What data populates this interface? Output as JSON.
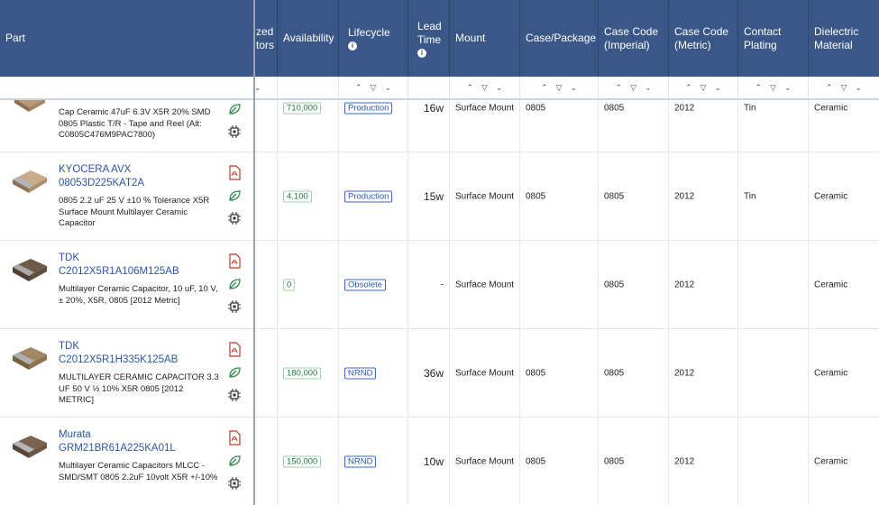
{
  "header": {
    "part": "Part",
    "hidden_col": [
      "zed",
      "tors"
    ],
    "availability": "Availability",
    "lifecycle": "Lifecycle",
    "lead_time": [
      "Lead",
      "Time"
    ],
    "mount": "Mount",
    "case_package": "Case/Package",
    "case_imperial": [
      "Case Code",
      "(Imperial)"
    ],
    "case_metric": [
      "Case Code",
      "(Metric)"
    ],
    "contact_plating": [
      "Contact",
      "Plating"
    ],
    "dielectric": [
      "Dielectric",
      "Material"
    ],
    "info_glyph": "i"
  },
  "rows": [
    {
      "manufacturer": "",
      "part_number": "",
      "description": "Cap Ceramic 47uF 6.3V X5R 20% SMD 0805 Plastic T/R - Tape and Reel (Alt: C0805C476M9PAC7800)",
      "availability": "710,000",
      "lifecycle": "Production",
      "lead_time": "16w",
      "mount": "Surface Mount",
      "case_package": "0805",
      "case_imperial": "0805",
      "case_metric": "2012",
      "contact_plating": "Tin",
      "dielectric": "Ceramic",
      "has_pdf": false
    },
    {
      "manufacturer": "KYOCERA AVX",
      "part_number": "08053D225KAT2A",
      "description": "0805 2.2 uF 25 V ±10 % Tolerance X5R Surface Mount Multilayer Ceramic Capacitor",
      "availability": "4,100",
      "lifecycle": "Production",
      "lead_time": "15w",
      "mount": "Surface Mount",
      "case_package": "0805",
      "case_imperial": "0805",
      "case_metric": "2012",
      "contact_plating": "Tin",
      "dielectric": "Ceramic",
      "has_pdf": true
    },
    {
      "manufacturer": "TDK",
      "part_number": "C2012X5R1A106M125AB",
      "description": "Multilayer Ceramic Capacitor, 10 uF, 10 V, ± 20%, X5R, 0805 [2012 Metric]",
      "availability": "0",
      "lifecycle": "Obsolete",
      "lead_time": "-",
      "mount": "Surface Mount",
      "case_package": "",
      "case_imperial": "0805",
      "case_metric": "2012",
      "contact_plating": "",
      "dielectric": "Ceramic",
      "has_pdf": true
    },
    {
      "manufacturer": "TDK",
      "part_number": "C2012X5R1H335K125AB",
      "description": "MULTILAYER CERAMIC CAPACITOR 3.3 UF 50 V ½ 10% X5R 0805 [2012 METRIC]",
      "availability": "180,000",
      "lifecycle": "NRND",
      "lead_time": "36w",
      "mount": "Surface Mount",
      "case_package": "0805",
      "case_imperial": "0805",
      "case_metric": "2012",
      "contact_plating": "",
      "dielectric": "Ceramic",
      "has_pdf": true
    },
    {
      "manufacturer": "Murata",
      "part_number": "GRM21BR61A225KA01L",
      "description": "Multilayer Ceramic Capacitors MLCC - SMD/SMT 0805 2.2uF 10volt X5R +/-10%",
      "availability": "150,000",
      "lifecycle": "NRND",
      "lead_time": "10w",
      "mount": "Surface Mount",
      "case_package": "0805",
      "case_imperial": "0805",
      "case_metric": "2012",
      "contact_plating": "",
      "dielectric": "Ceramic",
      "has_pdf": true
    }
  ],
  "colors": {
    "header_bg": "#3a5787",
    "link": "#2a56a8",
    "availability": "#1f7a3d",
    "lifecycle": "#2a58b5",
    "pdf": "#c0392b",
    "leaf": "#2e8b4a"
  },
  "icons": [
    "pdf-icon",
    "leaf-icon",
    "chip-icon",
    "sort-up-icon",
    "filter-icon",
    "sort-down-icon",
    "info-icon"
  ]
}
